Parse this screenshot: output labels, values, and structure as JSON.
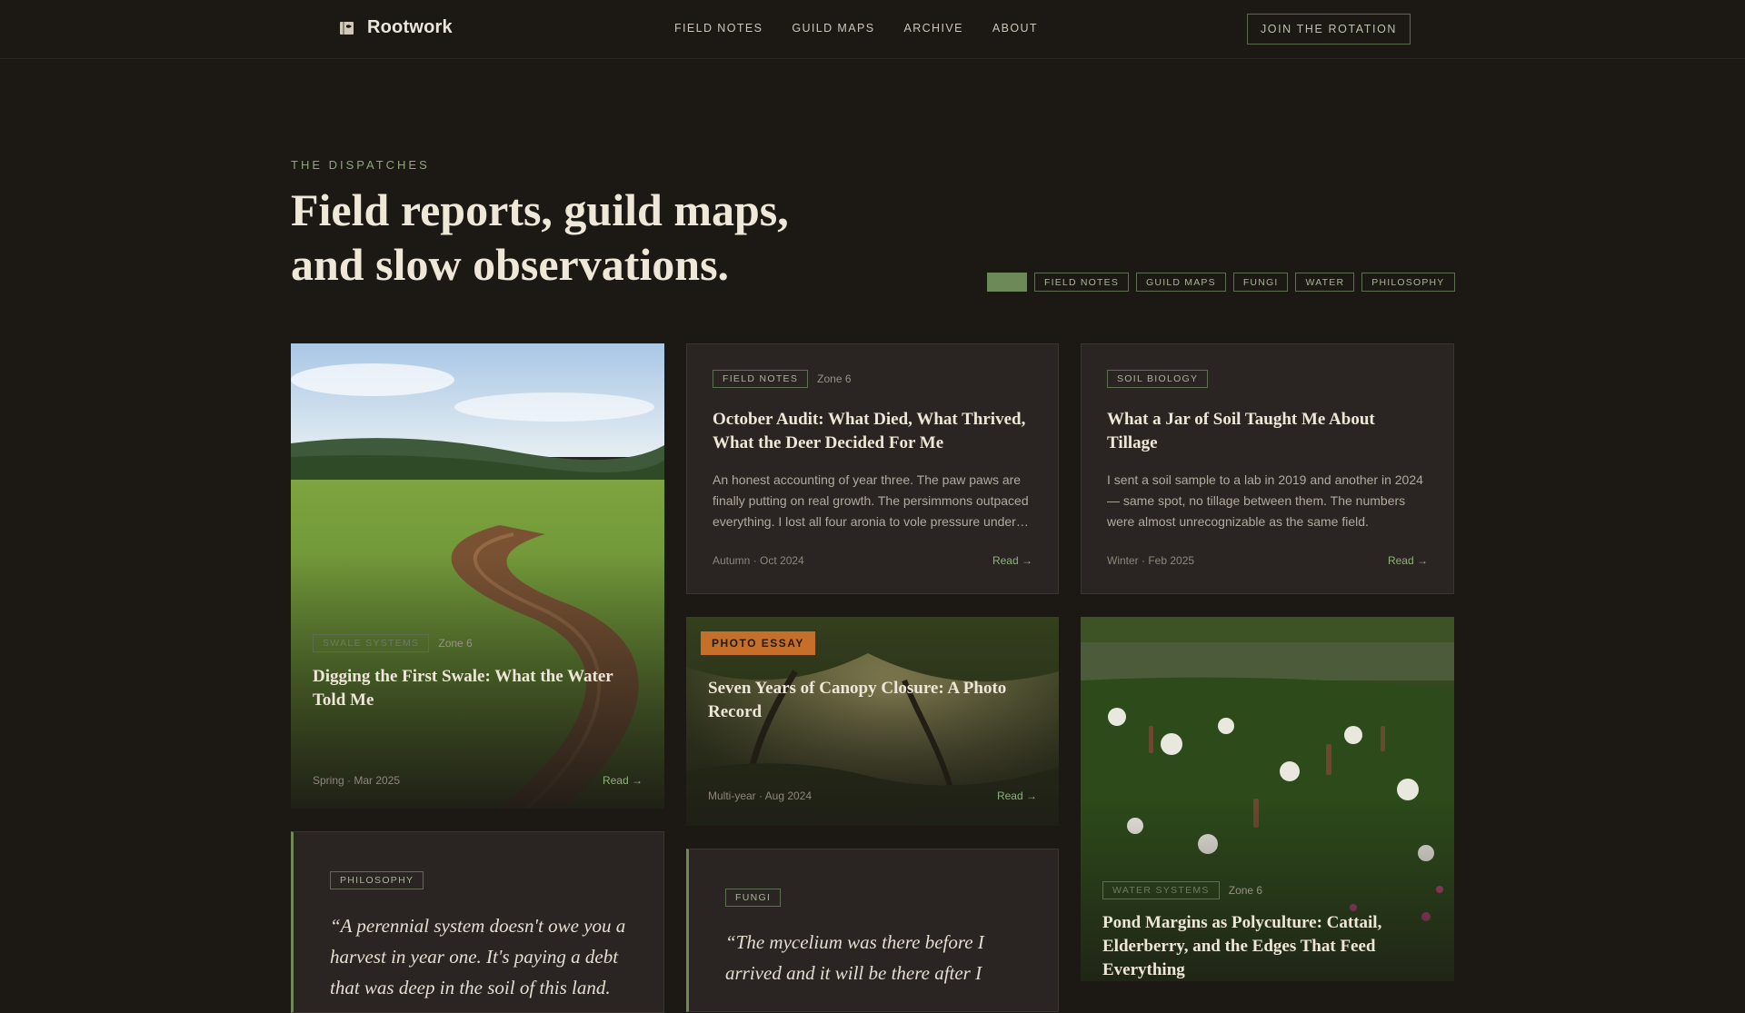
{
  "brand": {
    "name": "Rootwork"
  },
  "nav": {
    "items": [
      "FIELD NOTES",
      "GUILD MAPS",
      "ARCHIVE",
      "ABOUT"
    ],
    "cta": "JOIN THE ROTATION"
  },
  "hero": {
    "eyebrow": "THE DISPATCHES",
    "title_line1": "Field reports, guild maps,",
    "title_line2": "and slow observations."
  },
  "filters": {
    "chips": [
      "",
      "FIELD NOTES",
      "GUILD MAPS",
      "FUNGI",
      "WATER",
      "PHILOSOPHY"
    ]
  },
  "cards": {
    "swale": {
      "tag": "SWALE SYSTEMS",
      "zone": "Zone 6",
      "title": "Digging the First Swale: What the Water Told Me",
      "meta": "Spring · Mar 2025",
      "read": "Read →"
    },
    "audit": {
      "tag": "FIELD NOTES",
      "zone": "Zone 6",
      "title": "October Audit: What Died, What Thrived, What the Deer Decided For Me",
      "excerpt": "An honest accounting of year three. The paw paws are finally putting on real growth. The persimmons outpaced everything. I lost all four aronia to vole pressure under…",
      "meta": "Autumn · Oct 2024",
      "read": "Read →"
    },
    "soil": {
      "tag": "SOIL BIOLOGY",
      "title": "What a Jar of Soil Taught Me About Tillage",
      "excerpt": "I sent a soil sample to a lab in 2019 and another in 2024 — same spot, no tillage between them. The numbers were almost unrecognizable as the same field.",
      "meta": "Winter · Feb 2025",
      "read": "Read →"
    },
    "canopy": {
      "tag": "PHOTO ESSAY",
      "title": "Seven Years of Canopy Closure: A Photo Record",
      "meta": "Multi-year · Aug 2024",
      "read": "Read →"
    },
    "pond": {
      "tag": "WATER SYSTEMS",
      "zone": "Zone 6",
      "title": "Pond Margins as Polyculture: Cattail, Elderberry, and the Edges That Feed Everything"
    },
    "philosophy": {
      "tag": "PHILOSOPHY",
      "quote": "“A perennial system doesn't owe you a harvest in year one. It's paying a debt that was deep in the soil of this land."
    },
    "fungi": {
      "tag": "FUNGI",
      "quote": "“The mycelium was there before I arrived and it will be there after I"
    }
  }
}
